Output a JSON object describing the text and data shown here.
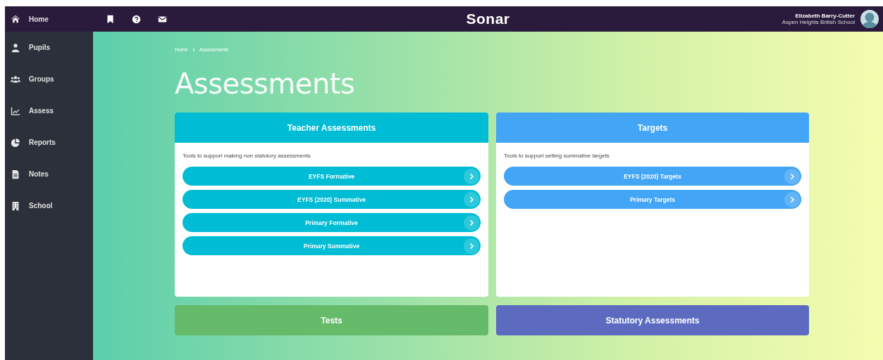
{
  "sidebar": {
    "items": [
      {
        "label": "Home",
        "selected": true
      },
      {
        "label": "Pupils",
        "selected": false
      },
      {
        "label": "Groups",
        "selected": false
      },
      {
        "label": "Assess",
        "selected": false
      },
      {
        "label": "Reports",
        "selected": false
      },
      {
        "label": "Notes",
        "selected": false
      },
      {
        "label": "School",
        "selected": false
      }
    ]
  },
  "topbar": {
    "logo": "Sonar",
    "user": {
      "name": "Elizabeth Barry-Cutter",
      "school": "Aspen Heights British School"
    }
  },
  "breadcrumb": [
    "Home",
    "Assessments"
  ],
  "title": "Assessments",
  "cards": [
    {
      "title": "Teacher Assessments",
      "color": "#00bcd4",
      "description": "Tools to support making non statutory assessments",
      "links": [
        "EYFS Formative",
        "EYFS (2020) Summative",
        "Primary Formative",
        "Primary Summative"
      ]
    },
    {
      "title": "Targets",
      "color": "#42a5f5",
      "description": "Tools to support setting summative targets",
      "links": [
        "EYFS (2020) Targets",
        "Primary Targets"
      ]
    },
    {
      "title": "Tests",
      "color": "#66bb6a"
    },
    {
      "title": "Statutory Assessments",
      "color": "#5c6bc0"
    }
  ]
}
